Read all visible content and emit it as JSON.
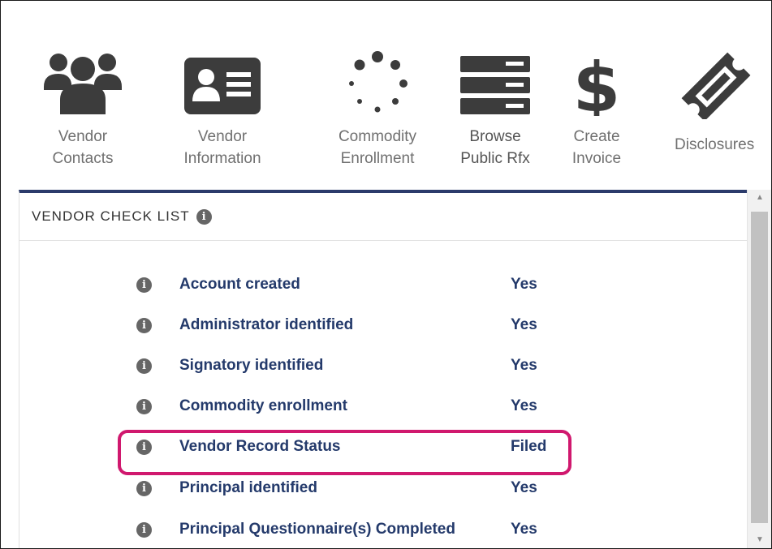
{
  "nav": {
    "items": [
      {
        "line1": "Vendor",
        "line2": "Contacts",
        "icon": "people-icon"
      },
      {
        "line1": "Vendor",
        "line2": "Information",
        "icon": "id-card-icon"
      },
      {
        "line1": "Commodity",
        "line2": "Enrollment",
        "icon": "spinner-dots-icon"
      },
      {
        "line1": "Browse",
        "line2": "Public Rfx",
        "icon": "server-list-icon"
      },
      {
        "line1": "Create",
        "line2": "Invoice",
        "icon": "dollar-icon"
      },
      {
        "line1": "Disclosures",
        "line2": "",
        "icon": "ticket-icon"
      }
    ]
  },
  "checklist": {
    "title": "VENDOR CHECK LIST",
    "items": [
      {
        "label": "Account created",
        "value": "Yes"
      },
      {
        "label": "Administrator identified",
        "value": "Yes"
      },
      {
        "label": "Signatory identified",
        "value": "Yes"
      },
      {
        "label": "Commodity enrollment",
        "value": "Yes"
      },
      {
        "label": "Vendor Record Status",
        "value": "Filed",
        "highlighted": true
      },
      {
        "label": "Principal identified",
        "value": "Yes"
      },
      {
        "label": "Principal Questionnaire(s) Completed",
        "value": "Yes"
      }
    ]
  },
  "colors": {
    "icon": "#3c3c3c",
    "panel_accent": "#2b3b6b",
    "item_text": "#243a6b",
    "highlight": "#d0186e"
  }
}
